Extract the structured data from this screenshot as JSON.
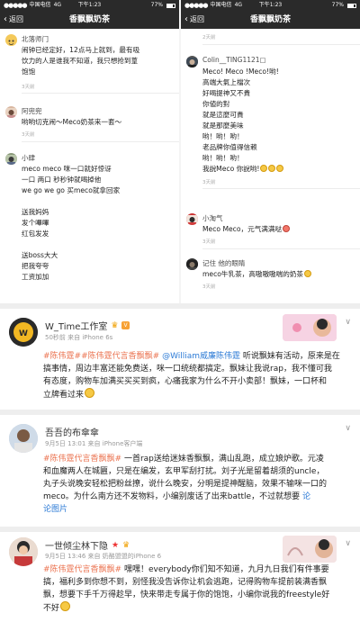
{
  "statusbar": {
    "carrier": "中国电信",
    "network": "4G",
    "time": "下午1:23",
    "battery": "77%"
  },
  "navbar": {
    "back_label": "返回",
    "title": "香飘飘奶茶"
  },
  "left_panel": {
    "items": [
      {
        "name": "北落师门",
        "ago": "",
        "lines": [
          "闹钟已经定好，12点马上就到，最有吸",
          "饮力的人是谁我不知道，我只想抢到葟",
          "饱饱"
        ],
        "time": "3天前"
      },
      {
        "name": "阿兜兜",
        "ago": "",
        "lines": [
          "哟哟切克闹～Meco奶茶来一套～"
        ],
        "time": "3天前"
      },
      {
        "name": "小肆",
        "ago": "",
        "lines": [
          "meco  meco    咪一口就好惊讶",
          "一口  两口    秒秒钟就喝掉他",
          "we go we go  买meco就拿回家",
          "",
          "送我妈妈",
          "发个嗶嗶",
          "红包发发",
          "",
          "送boss大大",
          "把我夸夸",
          "工资加加"
        ],
        "time": ""
      }
    ]
  },
  "right_panel": {
    "top_ago": "2天前",
    "items": [
      {
        "name": "Colin__TING1121▢",
        "lines": [
          "Meco! Meco !Meco!哟!",
          "高端大氣上檔次",
          "好喝提神又不貴",
          "你値的對",
          "就是這麼可貴",
          "就是那麼美味",
          "  哟！哟！哟！",
          "    老品牌你值得信赖",
          "  哟！哟！哟！",
          "我說Meco 你說哟!"
        ],
        "time": "3天前"
      },
      {
        "name": "小淘气",
        "lines": [
          "Meco Meco，元气满满哒"
        ],
        "time": "3天前"
      },
      {
        "name": "记住 他的眼睛",
        "lines": [
          "meco牛乳茶，高嗷嗷嗷喘的奶茶"
        ],
        "time": "3天前"
      }
    ]
  },
  "posts": [
    {
      "name": "W_Time工作室",
      "badge": "V",
      "meta": "50秒前 来自 iPhone 6s",
      "lines": [
        [
          {
            "t": "#陈伟霆#",
            "c": "topic"
          },
          {
            "t": "#陈伟霆代言香飘飘#",
            "c": "topic"
          },
          {
            "t": " ",
            "c": ""
          },
          {
            "t": "@William威廉陈伟霆",
            "c": "at"
          },
          {
            "t": " 听说飘妹有活动，原来是在",
            "c": ""
          }
        ],
        [
          {
            "t": "搞事情，周边丰富还能免费送，咪一口统统都搞定。飘妹让我说rap，我不懂可我",
            "c": ""
          }
        ],
        [
          {
            "t": "有态度，购物车加满买买买到疯，心痛我家为什么不开小卖部！飘妹，一口杯和",
            "c": ""
          }
        ],
        [
          {
            "t": "立牌看过来",
            "c": ""
          }
        ]
      ]
    },
    {
      "name": "吾吾的布傘傘",
      "badge": "",
      "meta": "9月5日 13:01 来自 iPhone客户端",
      "lines": [
        [
          {
            "t": "#陈伟霆代言香飘飘#",
            "c": "topic"
          },
          {
            "t": " 一首rap送给迷妹香飘飘，满山乱跑，成立娘炉歌。元凌",
            "c": ""
          }
        ],
        [
          {
            "t": "和血魔两人在城匾，只是在编发，玄甲军刮打扰。刘子光是留着胡须的uncle，",
            "c": ""
          }
        ],
        [
          {
            "t": "丸子头说晚安轻松把粉丝撩，说什么晚安，分明是提神醒脑，效果不输咪一口的",
            "c": ""
          }
        ],
        [
          {
            "t": "meco。为什么南方还不发物料，小编别废话了出来battle，不过就想要",
            "c": ""
          },
          {
            "t": " 论",
            "c": "at"
          }
        ],
        [
          {
            "t": "论图片",
            "c": "at"
          }
        ]
      ]
    },
    {
      "name": "一世倾尘林下隐",
      "badge": "★",
      "meta": "9月5日 13:46 来自 奶酪盟盟的iPhone 6",
      "lines": [
        [
          {
            "t": "#陈伟霆代言香飘飘#",
            "c": "topic"
          },
          {
            "t": " 嘿嘿！everybody你们知不知道，九月九日我们有件事要",
            "c": ""
          }
        ],
        [
          {
            "t": "搞，福利多到你想不到，别怪我没告诉你让机会逃跑，记得购物车提前装满香飘",
            "c": ""
          }
        ],
        [
          {
            "t": "飘，想要下手千万得趁早，快来带走专属于你的饱饱，小编你说我的freestyle好",
            "c": ""
          }
        ],
        [
          {
            "t": "不好",
            "c": ""
          }
        ]
      ]
    }
  ]
}
